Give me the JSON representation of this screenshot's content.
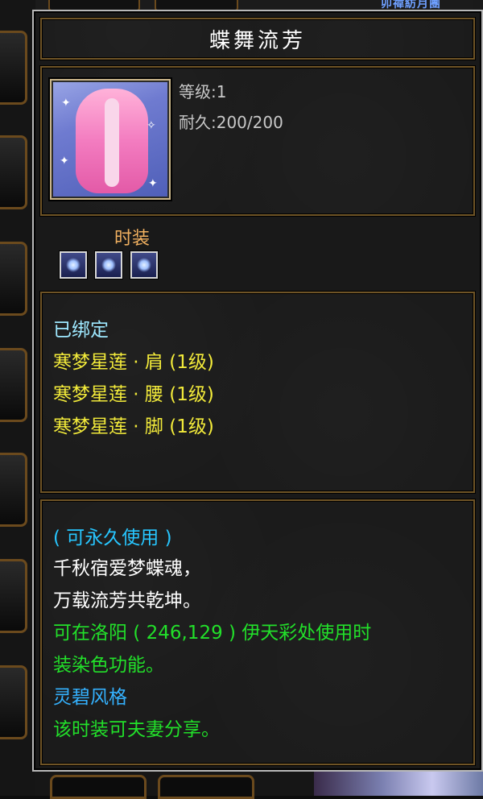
{
  "top_bar_text": "卯禕紡月團",
  "item": {
    "name": "蝶舞流芳",
    "level_label": "等级:1",
    "durability_label": "耐久:200/200",
    "category": "时装",
    "sockets": 3
  },
  "bind_section": {
    "status": "已绑定",
    "set_parts": [
      "寒梦星莲 · 肩 (1级)",
      "寒梦星莲 · 腰 (1级)",
      "寒梦星莲 · 脚 (1级)"
    ]
  },
  "description": {
    "usage": "( 可永久使用 )",
    "poem_line_1": "千秋宿爱梦蝶魂，",
    "poem_line_2": "万载流芳共乾坤。",
    "dye_line_1": "可在洛阳 ( 246,129 ) 伊天彩处使用时",
    "dye_line_2": "装染色功能。",
    "style": "灵碧风格",
    "share": "该时装可夫妻分享。"
  },
  "colors": {
    "bind_status": "#9ee8ff",
    "set_parts": "#f2ea3a",
    "usage": "#27c6ff",
    "poem": "#ffffff",
    "dye": "#22e02a",
    "style": "#34b2ff",
    "share": "#22e02a",
    "category": "#f0b060",
    "stats": "#c8c8c8",
    "title": "#ffffff"
  },
  "icons": {
    "item": "costume-icon",
    "socket": "socket-gem-icon"
  }
}
